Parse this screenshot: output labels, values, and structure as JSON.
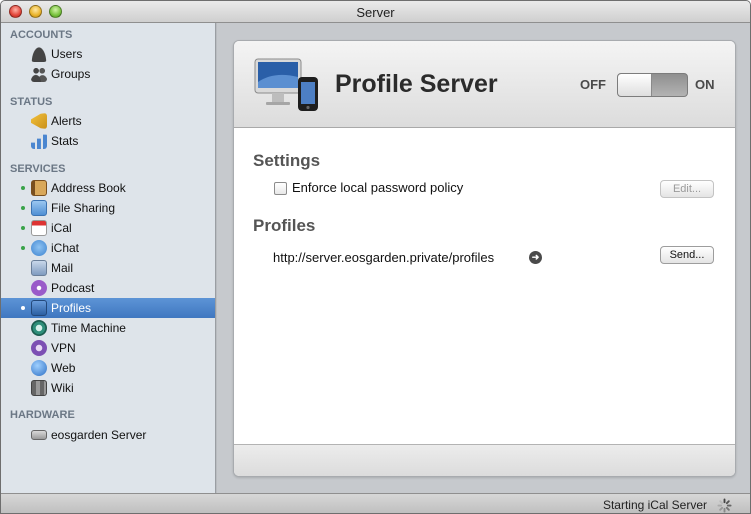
{
  "window": {
    "title": "Server"
  },
  "sidebar": {
    "sections": [
      {
        "title": "ACCOUNTS",
        "items": [
          {
            "label": "Users",
            "icon": "user-icon",
            "dot": false
          },
          {
            "label": "Groups",
            "icon": "group-icon",
            "dot": false
          }
        ]
      },
      {
        "title": "STATUS",
        "items": [
          {
            "label": "Alerts",
            "icon": "megaphone-icon",
            "dot": false
          },
          {
            "label": "Stats",
            "icon": "bar-chart-icon",
            "dot": false
          }
        ]
      },
      {
        "title": "SERVICES",
        "items": [
          {
            "label": "Address Book",
            "icon": "address-book-icon",
            "dot": true
          },
          {
            "label": "File Sharing",
            "icon": "folder-icon",
            "dot": true
          },
          {
            "label": "iCal",
            "icon": "calendar-icon",
            "dot": true
          },
          {
            "label": "iChat",
            "icon": "chat-bubble-icon",
            "dot": true
          },
          {
            "label": "Mail",
            "icon": "mail-icon",
            "dot": false
          },
          {
            "label": "Podcast",
            "icon": "podcast-icon",
            "dot": false
          },
          {
            "label": "Profiles",
            "icon": "profile-icon",
            "dot": true,
            "selected": true
          },
          {
            "label": "Time Machine",
            "icon": "time-machine-icon",
            "dot": false
          },
          {
            "label": "VPN",
            "icon": "vpn-icon",
            "dot": false
          },
          {
            "label": "Web",
            "icon": "globe-icon",
            "dot": false
          },
          {
            "label": "Wiki",
            "icon": "wiki-icon",
            "dot": false
          }
        ]
      },
      {
        "title": "HARDWARE",
        "items": [
          {
            "label": "eosgarden Server",
            "icon": "mac-mini-icon",
            "dot": false
          }
        ]
      }
    ]
  },
  "main": {
    "title": "Profile Server",
    "toggle": {
      "off_label": "OFF",
      "on_label": "ON",
      "state": "off"
    },
    "settings": {
      "heading": "Settings",
      "checkbox_label": "Enforce local password policy",
      "checked": false,
      "edit_button": "Edit..."
    },
    "profiles": {
      "heading": "Profiles",
      "url": "http://server.eosgarden.private/profiles",
      "send_button": "Send..."
    }
  },
  "status": {
    "text": "Starting iCal Server"
  },
  "colors": {
    "selection": "#3f77c0",
    "running_dot": "#3aa34a",
    "sidebar_bg": "#dee4ea"
  }
}
